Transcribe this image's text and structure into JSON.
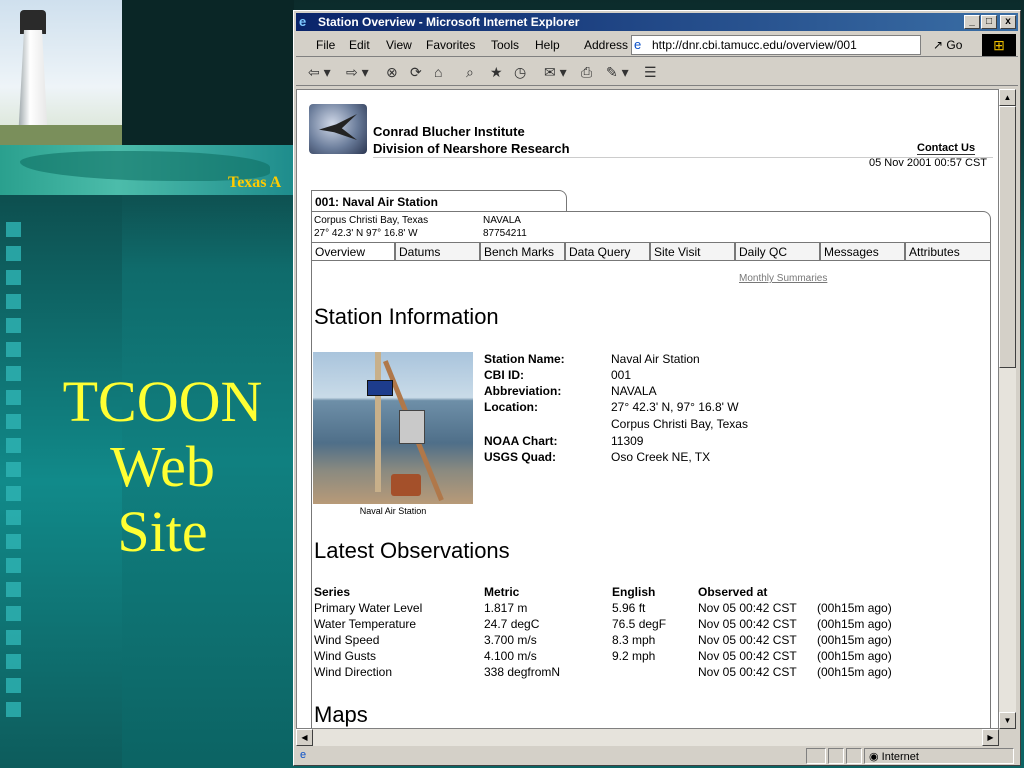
{
  "slide": {
    "title_lines": [
      "TCOON",
      "Web",
      "Site"
    ],
    "map_text": "Texas A",
    "colors": {
      "title": "#ffff33",
      "map_text": "#ffcc00"
    }
  },
  "window": {
    "title": "Station Overview - Microsoft Internet Explorer",
    "minimize": "_",
    "maximize": "□",
    "close": "x"
  },
  "menu": [
    "File",
    "Edit",
    "View",
    "Favorites",
    "Tools",
    "Help"
  ],
  "address": {
    "label": "Address",
    "url": "http://dnr.cbi.tamucc.edu/overview/001",
    "go_label": "Go"
  },
  "toolbar_icons": [
    "back-icon",
    "forward-icon",
    "stop-icon",
    "refresh-icon",
    "home-icon",
    "search-icon",
    "favorites-icon",
    "history-icon",
    "mail-icon",
    "print-icon",
    "edit-icon",
    "discuss-icon"
  ],
  "page": {
    "org_line1": "Conrad Blucher Institute",
    "org_line2": "Division of Nearshore Research",
    "contact": "Contact Us",
    "timestamp": "05 Nov 2001 00:57 CST",
    "station_tab": "001: Naval Air Station",
    "info": {
      "place": "Corpus Christi Bay, Texas",
      "abbrev": "NAVALA",
      "coords": "27° 42.3' N  97° 16.8' W",
      "id": "87754211"
    },
    "tabs": [
      "Overview",
      "Datums",
      "Bench Marks",
      "Data Query",
      "Site Visit",
      "Daily QC",
      "Messages",
      "Attributes"
    ],
    "monthly_link": "Monthly Summaries",
    "station_info_heading": "Station Information",
    "photo_caption": "Naval Air Station",
    "station_fields": {
      "labels": [
        "Station Name:",
        "CBI ID:",
        "Abbreviation:",
        "Location:",
        "NOAA Chart:",
        "USGS Quad:"
      ],
      "values": [
        "Naval Air Station",
        "001",
        "NAVALA",
        "27° 42.3' N, 97° 16.8' W",
        "Corpus Christi Bay, Texas",
        "11309",
        "Oso Creek NE, TX"
      ]
    },
    "latest_heading": "Latest Observations",
    "obs_headers": [
      "Series",
      "Metric",
      "English",
      "Observed at"
    ],
    "observations": [
      [
        "Primary Water Level",
        "1.817 m",
        "5.96 ft",
        "Nov 05 00:42 CST",
        "(00h15m ago)"
      ],
      [
        "Water Temperature",
        "24.7 degC",
        "76.5 degF",
        "Nov 05 00:42 CST",
        "(00h15m ago)"
      ],
      [
        "Wind Speed",
        "3.700 m/s",
        "8.3 mph",
        "Nov 05 00:42 CST",
        "(00h15m ago)"
      ],
      [
        "Wind Gusts",
        "4.100 m/s",
        "9.2 mph",
        "Nov 05 00:42 CST",
        "(00h15m ago)"
      ],
      [
        "Wind Direction",
        "338 degfromN",
        "",
        "Nov 05 00:42 CST",
        "(00h15m ago)"
      ]
    ],
    "maps_heading": "Maps"
  },
  "status": {
    "zone": "Internet"
  }
}
